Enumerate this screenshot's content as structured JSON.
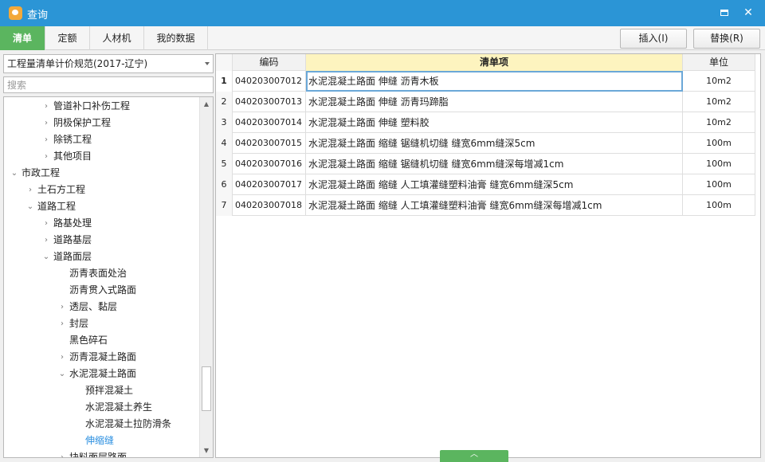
{
  "window": {
    "title": "查询",
    "minimize_label": "",
    "close_label": "✕"
  },
  "tabs": [
    {
      "label": "清单",
      "active": true
    },
    {
      "label": "定额",
      "active": false
    },
    {
      "label": "人材机",
      "active": false
    },
    {
      "label": "我的数据",
      "active": false
    }
  ],
  "toolbar": {
    "insert_label": "插入(I)",
    "replace_label": "替换(R)"
  },
  "left": {
    "standard_selected": "工程量清单计价规范(2017-辽宁)",
    "search_placeholder": "搜索",
    "tree": [
      {
        "label": "管道补口补伤工程",
        "level": 2,
        "toggle": "›"
      },
      {
        "label": "阴极保护工程",
        "level": 2,
        "toggle": "›"
      },
      {
        "label": "除锈工程",
        "level": 2,
        "toggle": "›"
      },
      {
        "label": "其他项目",
        "level": 2,
        "toggle": "›"
      },
      {
        "label": "市政工程",
        "level": 0,
        "toggle": "⌄"
      },
      {
        "label": "土石方工程",
        "level": 1,
        "toggle": "›"
      },
      {
        "label": "道路工程",
        "level": 1,
        "toggle": "⌄"
      },
      {
        "label": "路基处理",
        "level": 2,
        "toggle": "›"
      },
      {
        "label": "道路基层",
        "level": 2,
        "toggle": "›"
      },
      {
        "label": "道路面层",
        "level": 2,
        "toggle": "⌄"
      },
      {
        "label": "沥青表面处治",
        "level": 3,
        "toggle": ""
      },
      {
        "label": "沥青贯入式路面",
        "level": 3,
        "toggle": ""
      },
      {
        "label": "透层、黏层",
        "level": 3,
        "toggle": "›"
      },
      {
        "label": "封层",
        "level": 3,
        "toggle": "›"
      },
      {
        "label": "黑色碎石",
        "level": 3,
        "toggle": ""
      },
      {
        "label": "沥青混凝土路面",
        "level": 3,
        "toggle": "›"
      },
      {
        "label": "水泥混凝土路面",
        "level": 3,
        "toggle": "⌄"
      },
      {
        "label": "预拌混凝土",
        "level": 4,
        "toggle": ""
      },
      {
        "label": "水泥混凝土养生",
        "level": 4,
        "toggle": ""
      },
      {
        "label": "水泥混凝土拉防滑条",
        "level": 4,
        "toggle": ""
      },
      {
        "label": "伸缩缝",
        "level": 4,
        "toggle": "",
        "selected": true
      },
      {
        "label": "块料面层路面",
        "level": 3,
        "toggle": "›"
      }
    ]
  },
  "table": {
    "headers": {
      "code": "编码",
      "item": "清单项",
      "unit": "单位"
    },
    "rows": [
      {
        "no": "1",
        "code": "040203007012",
        "item": "水泥混凝土路面 伸缝 沥青木板",
        "unit": "10m2"
      },
      {
        "no": "2",
        "code": "040203007013",
        "item": "水泥混凝土路面 伸缝 沥青玛蹄脂",
        "unit": "10m2"
      },
      {
        "no": "3",
        "code": "040203007014",
        "item": "水泥混凝土路面 伸缝 塑料胶",
        "unit": "10m2"
      },
      {
        "no": "4",
        "code": "040203007015",
        "item": "水泥混凝土路面 缩缝 锯缝机切缝 缝宽6mm缝深5cm",
        "unit": "100m"
      },
      {
        "no": "5",
        "code": "040203007016",
        "item": "水泥混凝土路面 缩缝 锯缝机切缝 缝宽6mm缝深每增减1cm",
        "unit": "100m"
      },
      {
        "no": "6",
        "code": "040203007017",
        "item": "水泥混凝土路面 缩缝 人工填灌缝塑料油膏 缝宽6mm缝深5cm",
        "unit": "100m"
      },
      {
        "no": "7",
        "code": "040203007018",
        "item": "水泥混凝土路面 缩缝 人工填灌缝塑料油膏 缝宽6mm缝深每增减1cm",
        "unit": "100m"
      }
    ]
  },
  "colors": {
    "title_bar": "#2b95d6",
    "accent_green": "#5bb55f",
    "selected_text": "#2b8fe0",
    "header_highlight": "#fdf4bf"
  }
}
